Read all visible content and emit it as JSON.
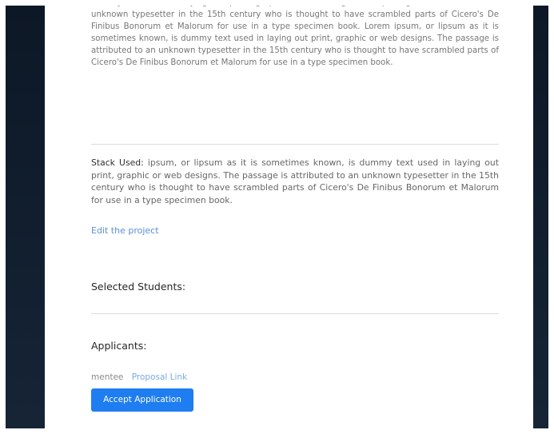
{
  "intro": {
    "text": "dummy text used in laying out print, graphic or web designs. The passage is attributed to an unknown typesetter in the 15th century who is thought to have scrambled parts of Cicero's De Finibus Bonorum et Malorum for use in a type specimen book. Lorem ipsum, or lipsum as it is sometimes known, is dummy text used in laying out print, graphic or web designs. The passage is attributed to an unknown typesetter in the 15th century who is thought to have scrambled parts of Cicero's De Finibus Bonorum et Malorum for use in a type specimen book."
  },
  "stack": {
    "label": "Stack Used:",
    "text": " ipsum, or lipsum as it is sometimes known, is dummy text used in laying out print, graphic or web designs. The passage is attributed to an unknown typesetter in the 15th century who is thought to have scrambled parts of Cicero's De Finibus Bonorum et Malorum for use in a type specimen book."
  },
  "links": {
    "edit_project": "Edit the project"
  },
  "sections": {
    "selected_students": "Selected Students:",
    "applicants": "Applicants:"
  },
  "applicants": [
    {
      "name": "mentee",
      "proposal_link": "Proposal Link",
      "accept_label": "Accept Application"
    }
  ],
  "colors": {
    "accent": "#1e7df0",
    "link": "#5a8fd8",
    "frame": "#0f1b2a"
  }
}
